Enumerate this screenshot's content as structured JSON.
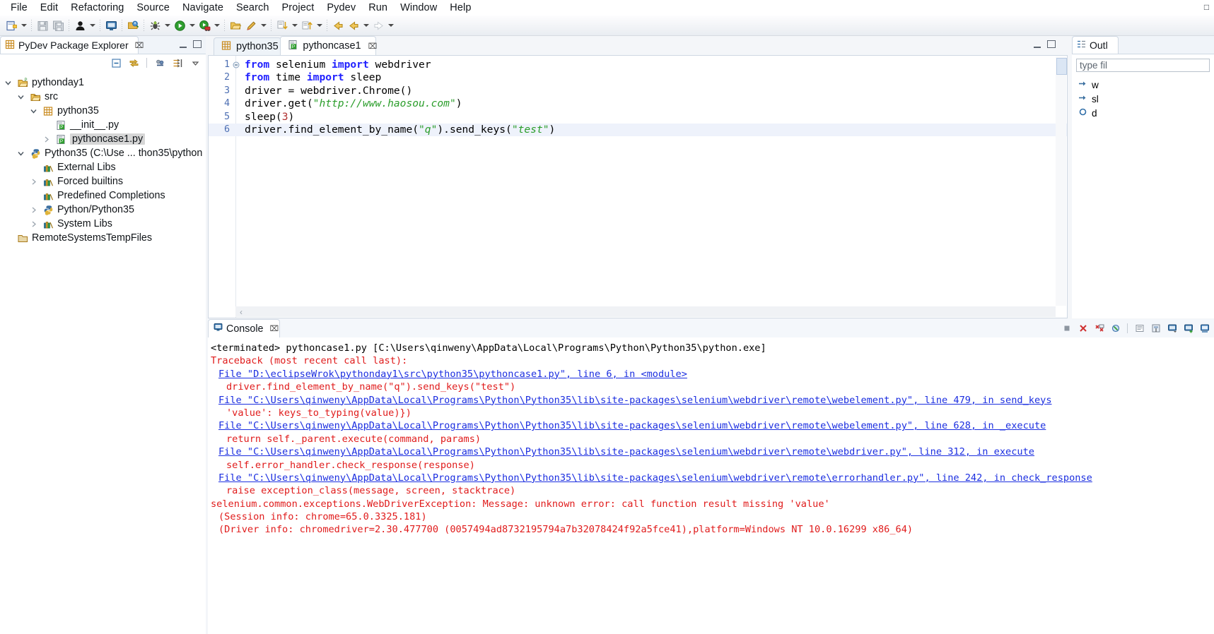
{
  "menu": {
    "items": [
      "File",
      "Edit",
      "Refactoring",
      "Source",
      "Navigate",
      "Search",
      "Project",
      "Pydev",
      "Run",
      "Window",
      "Help"
    ]
  },
  "toolbar": {
    "groups": [
      {
        "icons": [
          "new-file-icon",
          "dropdown-arrow"
        ]
      },
      {
        "icons": [
          "save-icon",
          "save-all-icon"
        ]
      },
      {
        "icons": [
          "person-icon",
          "dropdown-arrow"
        ]
      },
      {
        "icons": [
          "console-icon"
        ]
      },
      {
        "icons": [
          "open-type-icon"
        ]
      },
      {
        "icons": [
          "debug-icon",
          "dropdown-arrow"
        ]
      },
      {
        "icons": [
          "run-icon",
          "dropdown-arrow"
        ]
      },
      {
        "icons": [
          "coverage-icon",
          "dropdown-arrow"
        ]
      },
      {
        "icons": [
          "open-folder-icon"
        ]
      },
      {
        "icons": [
          "pencil-icon",
          "dropdown-arrow"
        ]
      },
      {
        "icons": [
          "next-annotation-icon",
          "dropdown-arrow"
        ]
      },
      {
        "icons": [
          "previous-annotation-icon",
          "dropdown-arrow"
        ]
      },
      {
        "icons": [
          "back-icon",
          "forward-icon",
          "dropdown-arrow"
        ]
      },
      {
        "icons": [
          "forward-arrow-icon",
          "dropdown-arrow"
        ]
      }
    ]
  },
  "explorer": {
    "title": "PyDev Package Explorer",
    "close_label": "⌧",
    "tools": [
      "collapse-all-icon",
      "link-with-editor-icon",
      "filter-icon",
      "focus-icon",
      "view-menu-icon"
    ],
    "tree": [
      {
        "label": "pythonday1",
        "depth": 0,
        "twist": "expanded",
        "icon": "project-folder-icon",
        "selected": false
      },
      {
        "label": "src",
        "depth": 1,
        "twist": "expanded",
        "icon": "source-folder-icon",
        "selected": false
      },
      {
        "label": "python35",
        "depth": 2,
        "twist": "expanded",
        "icon": "package-icon",
        "selected": false
      },
      {
        "label": "__init__.py",
        "depth": 3,
        "twist": "none",
        "icon": "init-file-icon",
        "selected": false
      },
      {
        "label": "pythoncase1.py",
        "depth": 3,
        "twist": "collapsed",
        "icon": "python-file-icon",
        "selected": true
      },
      {
        "label": "Python35  (C:\\Use ... thon35\\python",
        "depth": 1,
        "twist": "expanded",
        "icon": "interpreter-icon",
        "selected": false
      },
      {
        "label": "External Libs",
        "depth": 2,
        "twist": "none",
        "icon": "library-icon",
        "selected": false
      },
      {
        "label": "Forced builtins",
        "depth": 2,
        "twist": "collapsed",
        "icon": "library-icon",
        "selected": false
      },
      {
        "label": "Predefined Completions",
        "depth": 2,
        "twist": "none",
        "icon": "library-icon",
        "selected": false
      },
      {
        "label": "Python/Python35",
        "depth": 2,
        "twist": "collapsed",
        "icon": "interpreter-icon",
        "selected": false
      },
      {
        "label": "System Libs",
        "depth": 2,
        "twist": "collapsed",
        "icon": "library-icon",
        "selected": false
      },
      {
        "label": "RemoteSystemsTempFiles",
        "depth": 0,
        "twist": "none",
        "icon": "closed-project-icon",
        "selected": false
      }
    ]
  },
  "editor": {
    "tabs": [
      {
        "label": "python35",
        "icon": "package-icon",
        "active": false,
        "closeable": false
      },
      {
        "label": "pythoncase1",
        "icon": "python-file-icon",
        "active": true,
        "closeable": true,
        "close_label": "⌧"
      }
    ],
    "lines": [
      {
        "num": "1",
        "fold": true,
        "highlight": false,
        "tokens": [
          {
            "t": "from",
            "c": "k"
          },
          {
            "t": " selenium ",
            "c": "p"
          },
          {
            "t": "import",
            "c": "k"
          },
          {
            "t": " webdriver",
            "c": "p"
          }
        ]
      },
      {
        "num": "2",
        "fold": false,
        "highlight": false,
        "tokens": [
          {
            "t": "from",
            "c": "k"
          },
          {
            "t": " time ",
            "c": "p"
          },
          {
            "t": "import",
            "c": "k"
          },
          {
            "t": " sleep",
            "c": "p"
          }
        ]
      },
      {
        "num": "3",
        "fold": false,
        "highlight": false,
        "tokens": [
          {
            "t": "driver = webdriver.Chrome()",
            "c": "p"
          }
        ]
      },
      {
        "num": "4",
        "fold": false,
        "highlight": false,
        "tokens": [
          {
            "t": "driver.get(",
            "c": "p"
          },
          {
            "t": "\"http://www.haosou.com\"",
            "c": "s"
          },
          {
            "t": ")",
            "c": "p"
          }
        ]
      },
      {
        "num": "5",
        "fold": false,
        "highlight": false,
        "tokens": [
          {
            "t": "sleep(",
            "c": "p"
          },
          {
            "t": "3",
            "c": "n"
          },
          {
            "t": ")",
            "c": "p"
          }
        ]
      },
      {
        "num": "6",
        "fold": false,
        "highlight": true,
        "tokens": [
          {
            "t": "driver.find_element_by_name(",
            "c": "p"
          },
          {
            "t": "\"q\"",
            "c": "s"
          },
          {
            "t": ").send_keys(",
            "c": "p"
          },
          {
            "t": "\"test\"",
            "c": "s"
          },
          {
            "t": ")",
            "c": "p"
          }
        ]
      }
    ],
    "hscroll_left_glyph": "‹",
    "hscroll_right_glyph": "›"
  },
  "console": {
    "title": "Console",
    "close_label": "⌧",
    "tools": [
      "terminate-icon",
      "remove-launch-icon",
      "remove-all-terminated-icon",
      "clear-console-icon",
      "scroll-lock-icon",
      "pin-console-icon",
      "display-selected-console-icon",
      "open-console-icon",
      "word-wrap-icon"
    ],
    "header": "<terminated> pythoncase1.py [C:\\Users\\qinweny\\AppData\\Local\\Programs\\Python\\Python35\\python.exe]",
    "lines": [
      {
        "text": "Traceback (most recent call last):",
        "style": "err",
        "indent": 0
      },
      {
        "text": "File \"D:\\eclipseWrok\\pythonday1\\src\\python35\\pythoncase1.py\", line 6, in <module>",
        "style": "link",
        "indent": 1
      },
      {
        "text": "driver.find_element_by_name(\"q\").send_keys(\"test\")",
        "style": "err",
        "indent": 2
      },
      {
        "text": "File \"C:\\Users\\qinweny\\AppData\\Local\\Programs\\Python\\Python35\\lib\\site-packages\\selenium\\webdriver\\remote\\webelement.py\", line 479, in send_keys",
        "style": "link",
        "indent": 1
      },
      {
        "text": "'value': keys_to_typing(value)})",
        "style": "err",
        "indent": 2
      },
      {
        "text": "File \"C:\\Users\\qinweny\\AppData\\Local\\Programs\\Python\\Python35\\lib\\site-packages\\selenium\\webdriver\\remote\\webelement.py\", line 628, in _execute",
        "style": "link",
        "indent": 1
      },
      {
        "text": "return self._parent.execute(command, params)",
        "style": "err",
        "indent": 2
      },
      {
        "text": "File \"C:\\Users\\qinweny\\AppData\\Local\\Programs\\Python\\Python35\\lib\\site-packages\\selenium\\webdriver\\remote\\webdriver.py\", line 312, in execute",
        "style": "link",
        "indent": 1
      },
      {
        "text": "self.error_handler.check_response(response)",
        "style": "err",
        "indent": 2
      },
      {
        "text": "File \"C:\\Users\\qinweny\\AppData\\Local\\Programs\\Python\\Python35\\lib\\site-packages\\selenium\\webdriver\\remote\\errorhandler.py\", line 242, in check_response",
        "style": "link",
        "indent": 1
      },
      {
        "text": "raise exception_class(message, screen, stacktrace)",
        "style": "err",
        "indent": 2
      },
      {
        "text": "selenium.common.exceptions.WebDriverException: Message: unknown error: call function result missing 'value'",
        "style": "err",
        "indent": 0
      },
      {
        "text": "(Session info: chrome=65.0.3325.181)",
        "style": "err",
        "indent": 1
      },
      {
        "text": "(Driver info: chromedriver=2.30.477700 (0057494ad8732195794a7b32078424f92a5fce41),platform=Windows NT 10.0.16299 x86_64)",
        "style": "err",
        "indent": 1
      }
    ]
  },
  "outline": {
    "title": "Outl",
    "filter_placeholder": "type fil",
    "items": [
      {
        "label": "w",
        "icon": "import-icon"
      },
      {
        "label": "sl",
        "icon": "import-icon"
      },
      {
        "label": "d",
        "icon": "variable-icon"
      }
    ]
  },
  "window": {
    "restore_glyph": "❐",
    "minimize_glyph": "—",
    "maximize_glyph": "□"
  },
  "colors": {
    "keyword": "#2121ff",
    "string": "#2a9d2a",
    "number": "#b03030",
    "error": "#e01b1b",
    "link": "#1b2ee0",
    "selection": "#d6d6d6"
  }
}
